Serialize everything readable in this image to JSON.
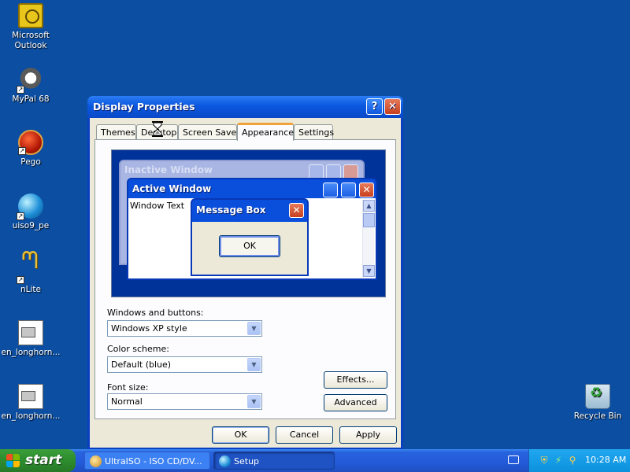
{
  "desktop": {
    "icons": [
      {
        "label": "Microsoft Outlook",
        "icon": "outlook-icon"
      },
      {
        "label": "MyPal 68",
        "icon": "mypal-icon"
      },
      {
        "label": "Pego",
        "icon": "pego-icon"
      },
      {
        "label": "uiso9_pe",
        "icon": "globe-icon"
      },
      {
        "label": "nLite",
        "icon": "nlite-icon"
      },
      {
        "label": "en_longhorn...",
        "icon": "file-icon"
      },
      {
        "label": "en_longhorn...",
        "icon": "file-icon"
      },
      {
        "label": "Recycle Bin",
        "icon": "recycle-bin-icon"
      }
    ]
  },
  "dialog": {
    "title": "Display Properties",
    "help_button": "?",
    "tabs": [
      {
        "label": "Themes"
      },
      {
        "label": "Desktop"
      },
      {
        "label": "Screen Saver"
      },
      {
        "label": "Appearance",
        "active": true
      },
      {
        "label": "Settings"
      }
    ],
    "preview": {
      "inactive_title": "Inactive Window",
      "active_title": "Active Window",
      "window_text": "Window Text",
      "message_title": "Message Box",
      "ok_label": "OK"
    },
    "fields": {
      "windows_buttons_label": "Windows and buttons:",
      "windows_buttons_value": "Windows XP style",
      "color_scheme_label": "Color scheme:",
      "color_scheme_value": "Default (blue)",
      "font_size_label": "Font size:",
      "font_size_value": "Normal"
    },
    "buttons": {
      "effects": "Effects...",
      "advanced": "Advanced",
      "ok": "OK",
      "cancel": "Cancel",
      "apply": "Apply"
    }
  },
  "taskbar": {
    "start_label": "start",
    "tasks": [
      {
        "label": "UltraISO - ISO CD/DV...",
        "icon": "ultraiso-icon"
      },
      {
        "label": "Setup",
        "icon": "setup-globe-icon",
        "active": true
      }
    ],
    "clock": "10:28 AM"
  },
  "colors": {
    "desktop": "#0b4ea2",
    "titlebar": "#0a58e0",
    "dialog_face": "#ece9d8",
    "tab_highlight": "#f0a23a",
    "start_button": "#2f8f2f",
    "tray": "#0d91dd"
  }
}
